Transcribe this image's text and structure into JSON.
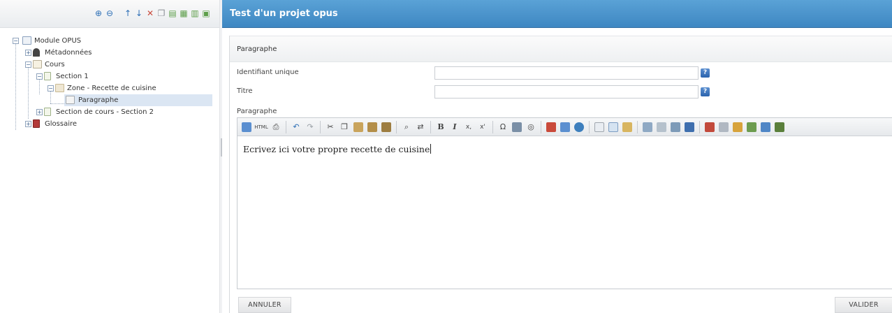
{
  "left_toolbar": {
    "tools": [
      "zoom-in-icon",
      "zoom-out-icon",
      "move-up-icon",
      "move-down-icon",
      "delete-icon",
      "copy-icon",
      "add-page-icon",
      "add-zone-icon",
      "add-element-icon",
      "add-sub-icon"
    ]
  },
  "tree": {
    "items": [
      {
        "label": "Module OPUS"
      },
      {
        "label": "Métadonnées"
      },
      {
        "label": "Cours"
      },
      {
        "label": "Section 1"
      },
      {
        "label": "Zone - Recette de cuisine"
      },
      {
        "label": "Paragraphe"
      },
      {
        "label": "Section de cours - Section 2"
      },
      {
        "label": "Glossaire"
      }
    ]
  },
  "main": {
    "title": "Test d'un projet opus",
    "section_header": "Paragraphe",
    "fields": {
      "identifiant_label": "Identifiant unique",
      "identifiant_value": "",
      "titre_label": "Titre",
      "titre_value": "",
      "help": "?"
    },
    "paragraphe_label": "Paragraphe",
    "editor": {
      "toolbar": {
        "html_label": "HTML",
        "bold": "B",
        "italic": "I",
        "subscript": "x,",
        "superscript": "x'",
        "omega": "Ω"
      },
      "content": "Ecrivez ici votre propre recette de cuisine"
    },
    "buttons": {
      "cancel": "ANNULER",
      "validate": "VALIDER"
    }
  },
  "colors": {
    "title_bar": "#4a93cc",
    "selected_row": "#dbe6f3"
  }
}
